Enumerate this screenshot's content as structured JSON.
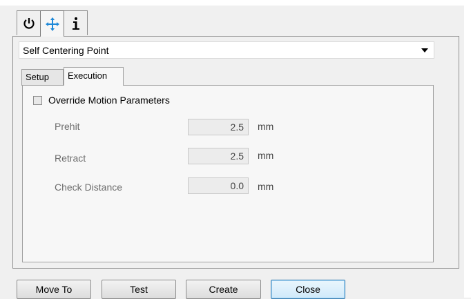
{
  "top_tabs": [
    {
      "icon": "power-icon"
    },
    {
      "icon": "move-arrows-icon"
    },
    {
      "icon": "info-icon"
    }
  ],
  "dropdown": {
    "selected": "Self Centering Point"
  },
  "tabs": [
    {
      "label": "Setup"
    },
    {
      "label": "Execution"
    }
  ],
  "override": {
    "label": "Override Motion Parameters",
    "checked": false
  },
  "fields": [
    {
      "label": "Prehit",
      "value": "2.5",
      "unit": "mm"
    },
    {
      "label": "Retract",
      "value": "2.5",
      "unit": "mm"
    },
    {
      "label": "Check Distance",
      "value": "0.0",
      "unit": "mm"
    }
  ],
  "buttons": {
    "move_to": "Move To",
    "test": "Test",
    "create": "Create",
    "close": "Close"
  },
  "colors": {
    "icon_blue": "#1e88d8",
    "close_border": "#3c7fb1"
  }
}
